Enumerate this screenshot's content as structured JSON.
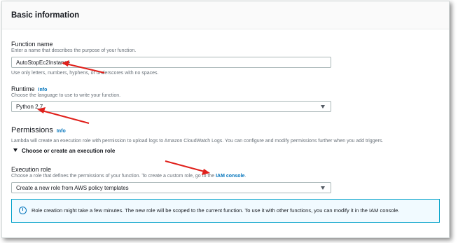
{
  "panel": {
    "title": "Basic information"
  },
  "function_name": {
    "label": "Function name",
    "description": "Enter a name that describes the purpose of your function.",
    "value": "AutoStopEc2Instance",
    "hint": "Use only letters, numbers, hyphens, or underscores with no spaces."
  },
  "runtime": {
    "label": "Runtime",
    "info": "Info",
    "description": "Choose the language to use to write your function.",
    "value": "Python 2.7"
  },
  "permissions": {
    "title": "Permissions",
    "info": "Info",
    "description": "Lambda will create an execution role with permission to upload logs to Amazon CloudWatch Logs. You can configure and modify permissions further when you add triggers.",
    "expander_label": "Choose or create an execution role"
  },
  "execution_role": {
    "label": "Execution role",
    "description_prefix": "Choose a role that defines the permissions of your function. To create a custom role, go to the",
    "link": "IAM console",
    "description_suffix": ".",
    "value": "Create a new role from AWS policy templates"
  },
  "alert": {
    "icon": "info-circle-icon",
    "text": "Role creation might take a few minutes. The new role will be scoped to the current function. To use it with other functions, you can modify it in the IAM console."
  },
  "annotation_color": "#e0201b"
}
